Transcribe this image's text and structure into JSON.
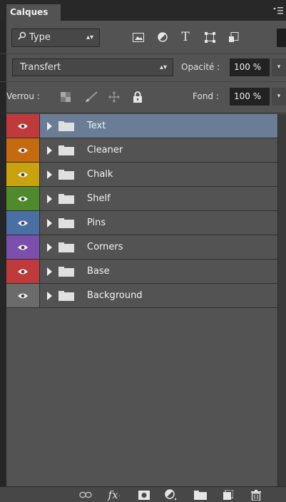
{
  "tab": {
    "title": "Calques"
  },
  "panel_menu_icon": "panel-menu-icon",
  "filter": {
    "kind_label": "Type",
    "icons": [
      "image-filter-icon",
      "adjustment-filter-icon",
      "text-filter-icon",
      "shape-filter-icon",
      "smart-object-filter-icon"
    ]
  },
  "blend": {
    "mode": "Transfert",
    "opacity_label": "Opacité :",
    "opacity_value": "100 %"
  },
  "lock": {
    "label": "Verrou :",
    "icons": [
      "lock-transparent-icon",
      "lock-brush-icon",
      "lock-move-icon",
      "lock-all-icon"
    ],
    "fill_label": "Fond :",
    "fill_value": "100 %"
  },
  "layers": [
    {
      "name": "Text",
      "color": "#c0393b",
      "selected": true
    },
    {
      "name": "Cleaner",
      "color": "#c56a0e",
      "selected": false
    },
    {
      "name": "Chalk",
      "color": "#c9a20e",
      "selected": false
    },
    {
      "name": "Shelf",
      "color": "#4f8a2b",
      "selected": false
    },
    {
      "name": "Pins",
      "color": "#4a6fa5",
      "selected": false
    },
    {
      "name": "Corners",
      "color": "#7a4fae",
      "selected": false
    },
    {
      "name": "Base",
      "color": "#c0393b",
      "selected": false
    },
    {
      "name": "Background",
      "color": "#6b6b6b",
      "selected": false
    }
  ],
  "bottom_icons": [
    "link-icon",
    "fx-icon",
    "mask-icon",
    "adjustment-icon",
    "group-folder-icon",
    "new-layer-icon",
    "trash-icon"
  ]
}
